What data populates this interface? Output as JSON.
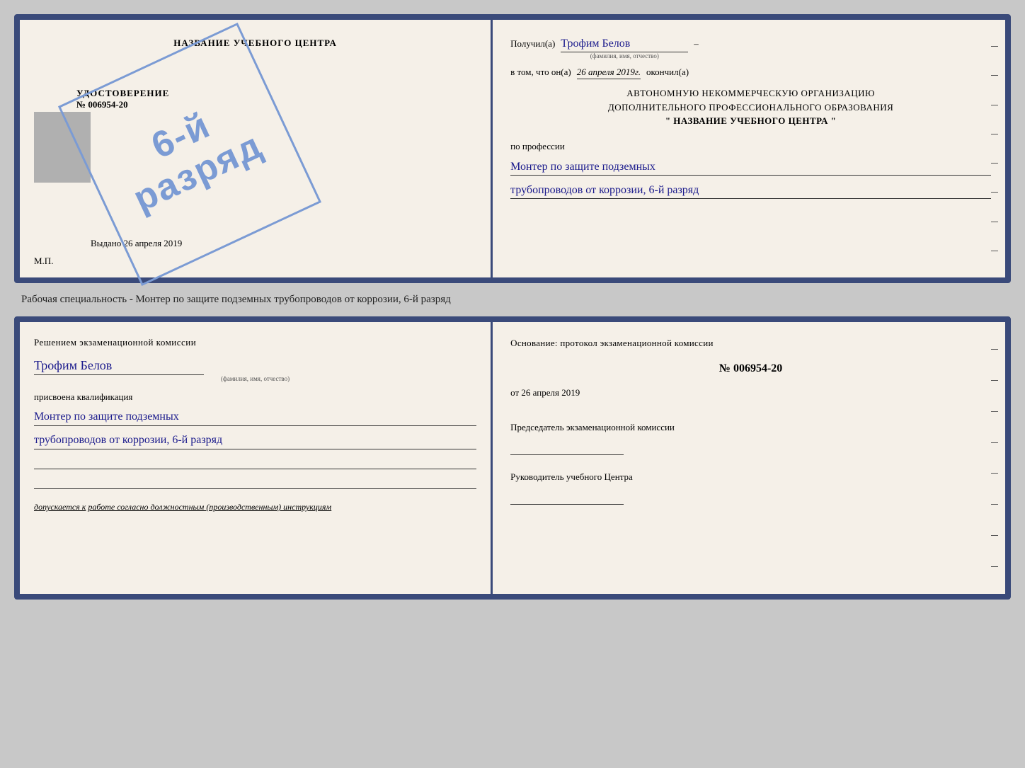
{
  "top_cert": {
    "left": {
      "title": "НАЗВАНИЕ УЧЕБНОГО ЦЕНТРА",
      "stamp_line1": "6-й",
      "stamp_line2": "разряд",
      "udostoverenie_label": "УДОСТОВЕРЕНИЕ",
      "number": "№ 006954-20",
      "vydano_label": "Выдано",
      "vydano_date": "26 апреля 2019",
      "mp": "М.П."
    },
    "right": {
      "poluchil_label": "Получил(а)",
      "receiver_name": "Трофим Белов",
      "fio_hint": "(фамилия, имя, отчество)",
      "dash": "–",
      "vtom_label": "в том, что он(а)",
      "date_value": "26 апреля 2019г.",
      "okonchil_label": "окончил(а)",
      "org_line1": "АВТОНОМНУЮ НЕКОММЕРЧЕСКУЮ ОРГАНИЗАЦИЮ",
      "org_line2": "ДОПОЛНИТЕЛЬНОГО ПРОФЕССИОНАЛЬНОГО ОБРАЗОВАНИЯ",
      "org_quote1": "\"",
      "org_name": "НАЗВАНИЕ УЧЕБНОГО ЦЕНТРА",
      "org_quote2": "\"",
      "po_professii": "по профессии",
      "profession_line1": "Монтер по защите подземных",
      "profession_line2": "трубопроводов от коррозии, 6-й разряд"
    }
  },
  "middle_text": "Рабочая специальность - Монтер по защите подземных трубопроводов от коррозии, 6-й разряд",
  "bottom_cert": {
    "left": {
      "section_title": "Решением экзаменационной комиссии",
      "person_name": "Трофим Белов",
      "fio_hint": "(фамилия, имя, отчество)",
      "assigned_label": "присвоена квалификация",
      "qual_line1": "Монтер по защите подземных",
      "qual_line2": "трубопроводов от коррозии, 6-й разряд",
      "допускается_label": "допускается к",
      "допускается_value": "работе согласно должностным (производственным) инструкциям"
    },
    "right": {
      "osnov_label": "Основание: протокол экзаменационной комиссии",
      "protocol_number": "№  006954-20",
      "protocol_date_prefix": "от",
      "protocol_date": "26 апреля 2019",
      "chairman_title": "Председатель экзаменационной комиссии",
      "head_title": "Руководитель учебного Центра"
    }
  }
}
